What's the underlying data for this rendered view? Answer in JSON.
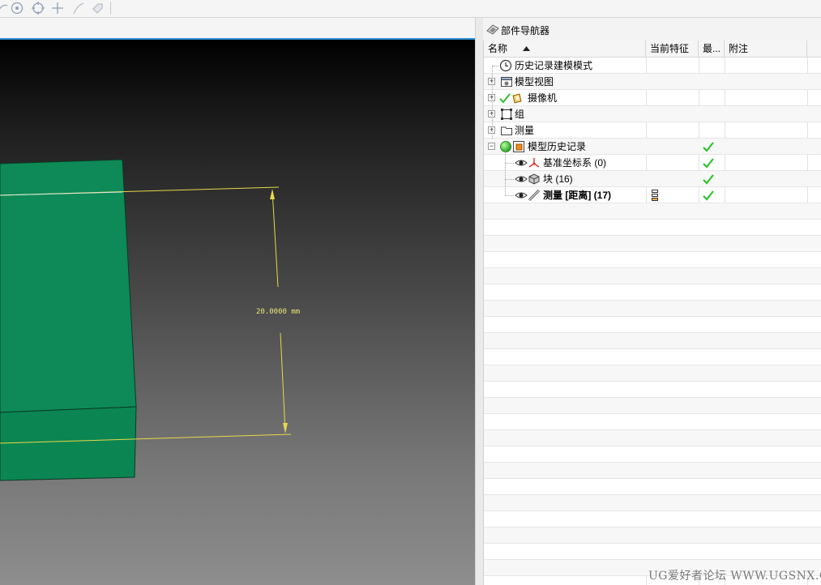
{
  "toolbar": {
    "icons": [
      "snap-arc-icon",
      "snap-center-icon",
      "snap-quadrant-icon",
      "snap-intersection-icon",
      "snap-curve-icon",
      "snap-tag-icon"
    ]
  },
  "viewport": {
    "dimension_text": "20.0000 mm",
    "colors": {
      "solid_face": "#0d8a57",
      "solid_edge": "#0b3a24",
      "dimension": "#e8d84a"
    }
  },
  "navigator": {
    "title": "部件导航器",
    "columns": {
      "name": "名称",
      "current_feature": "当前特征",
      "latest": "最...",
      "note": "附注"
    },
    "rows": [
      {
        "label": "历史记录建模模式",
        "icon": "clock-icon",
        "expander": "",
        "latest": false
      },
      {
        "label": "模型视图",
        "icon": "model-views-icon",
        "expander": "+",
        "latest": false
      },
      {
        "label": "摄像机",
        "icon": "camera-icon",
        "expander": "+",
        "latest": false
      },
      {
        "label": "组",
        "icon": "group-icon",
        "expander": "+",
        "latest": false
      },
      {
        "label": "测量",
        "icon": "folder-icon",
        "expander": "+",
        "latest": false
      },
      {
        "label": "模型历史记录",
        "icon": "model-history-icon",
        "expander": "−",
        "latest": true
      },
      {
        "label": "基准坐标系 (0)",
        "icon": "datum-csys-icon",
        "expander": "",
        "latest": true
      },
      {
        "label": "块 (16)",
        "icon": "block-icon",
        "expander": "",
        "latest": true
      },
      {
        "label": "测量 [距离] (17)",
        "icon": "measure-distance-icon",
        "expander": "",
        "latest": true,
        "current": true
      }
    ]
  },
  "watermark": "UG爱好者论坛 WWW.UGSNX.COM"
}
